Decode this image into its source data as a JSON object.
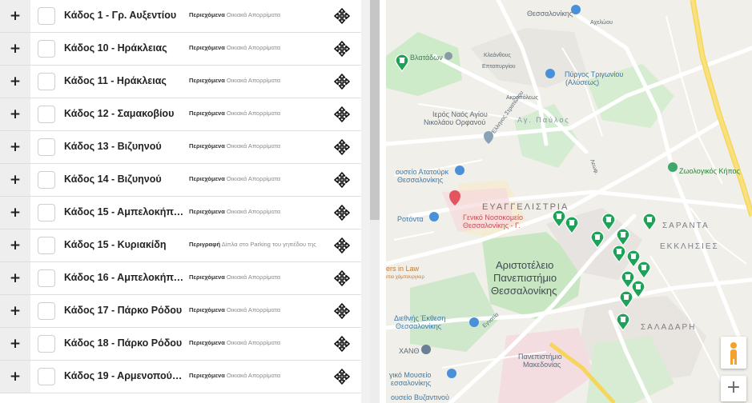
{
  "list": {
    "rows": [
      {
        "name": "Κάδος 1 - Γρ. Αυξεντίου",
        "desc_label": "Περιεχόμενα",
        "desc_value": "Οικιακά Απορρίματα"
      },
      {
        "name": "Κάδος 10 - Ηράκλειας",
        "desc_label": "Περιεχόμενα",
        "desc_value": "Οικιακά Απορρίματα"
      },
      {
        "name": "Κάδος 11 - Ηράκλειας",
        "desc_label": "Περιεχόμενα",
        "desc_value": "Οικιακά Απορρίματα"
      },
      {
        "name": "Κάδος 12 - Σαμακοβίου",
        "desc_label": "Περιεχόμενα",
        "desc_value": "Οικιακά Απορρίματα"
      },
      {
        "name": "Κάδος 13 - Βιζυηνού",
        "desc_label": "Περιεχόμενα",
        "desc_value": "Οικιακά Απορρίματα"
      },
      {
        "name": "Κάδος 14 - Βιζυηνού",
        "desc_label": "Περιεχόμενα",
        "desc_value": "Οικιακά Απορρίματα"
      },
      {
        "name": "Κάδος 15 - Αμπελοκήπων",
        "desc_label": "Περιεχόμενα",
        "desc_value": "Οικιακά Απορρίματα"
      },
      {
        "name": "Κάδος 15 - Κυριακίδη",
        "desc_label": "Περιγραφή",
        "desc_value": "Δίπλα στο Parking του γηπέδου της"
      },
      {
        "name": "Κάδος 16 - Αμπελοκήπων",
        "desc_label": "Περιεχόμενα",
        "desc_value": "Οικιακά Απορρίματα"
      },
      {
        "name": "Κάδος 17 - Πάρκο Ρόδου",
        "desc_label": "Περιεχόμενα",
        "desc_value": "Οικιακά Απορρίματα"
      },
      {
        "name": "Κάδος 18 - Πάρκο Ρόδου",
        "desc_label": "Περιεχόμενα",
        "desc_value": "Οικιακά Απορρίματα"
      },
      {
        "name": "Κάδος 19 - Αρμενοπούλου",
        "desc_label": "Περιεχόμενα",
        "desc_value": "Οικιακά Απορρίματα"
      }
    ]
  },
  "map": {
    "labels": {
      "top_thessaloniki": "Θεσσαλονίκης",
      "vlatadon": "Βλατάδων",
      "kleanthous": "Κλεάνθους",
      "epta_pyrgion": "Επταπυργίου",
      "axelou": "Αχελώου",
      "pyrgos": "Πύργος Τριγωνίου",
      "pyrgos_sub": "(Αλύσεως)",
      "akropoleos": "Ακροπόλεως",
      "naos_1": "Ιερός Ναός Αγίου",
      "naos_2": "Νικολάου Ορφανού",
      "ag_pavlos": "Αγ. Παύλος",
      "ellinos_stratiotou": "Έλληνος Στρατιώτου",
      "museum_ataturk_1": "ουσείο Ατατούρκ",
      "museum_ataturk_2": "Θεσσαλονίκης",
      "zoo": "Ζωολογικός Κήπος",
      "evangelistria": "ΕΥΑΓΓΕΛΙΣΤΡΙΑ",
      "hospital_1": "Γενικό Νοσοκομείο",
      "hospital_2": "Θεσσαλονίκης - Γ.",
      "rotonda": "Ροτόντα",
      "saranta_1": "ΣΑΡΑΝΤΑ",
      "saranta_2": "ΕΚΚΛΗΣΙΕΣ",
      "in_law_1": "ers in Law",
      "in_law_2": "ιπιο χάμπουργκερ",
      "auth_1": "Αριστοτέλειο",
      "auth_2": "Πανεπιστήμιο",
      "auth_3": "Θεσσαλονίκης",
      "diethnis_1": "Διεθνής Έκθεση",
      "diethnis_2": "Θεσσαλονίκης",
      "egnatia": "Εγνατία",
      "saladari": "ΣΑΛΑΔΑΡΗ",
      "xanth": "XANΘ",
      "pan_mak_1": "Πανεπιστήμιο",
      "pan_mak_2": "Μακεδονίας",
      "folk_1": "γικό Μουσείο",
      "folk_2": "εσσαλονίκης",
      "byz": "ουσείο Βυζαντινού",
      "leoforos": "Λεωφ."
    },
    "zoom_in": "+"
  }
}
